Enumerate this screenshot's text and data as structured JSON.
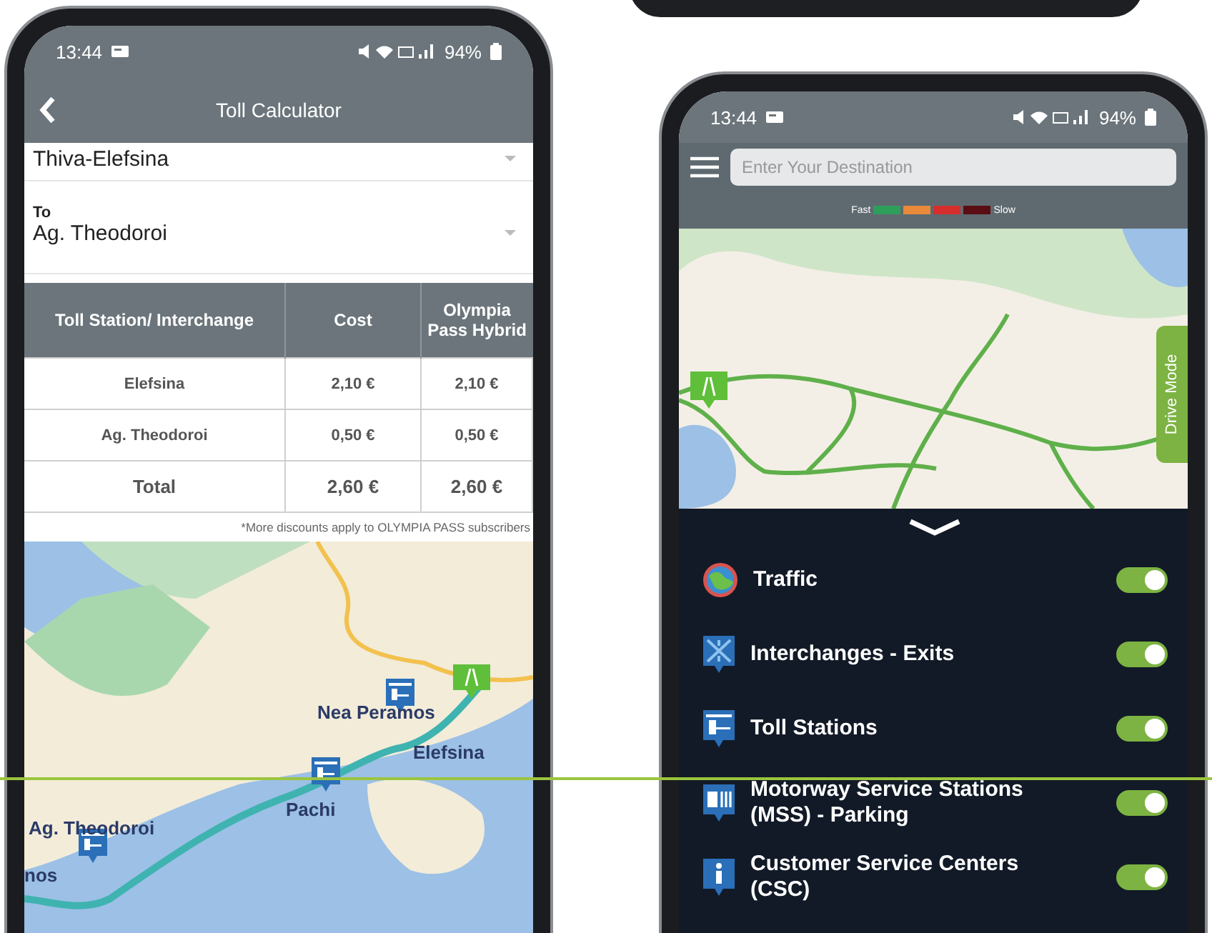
{
  "toll_calculator": {
    "status_bar": {
      "time": "13:44",
      "battery": "94%"
    },
    "title": "Toll Calculator",
    "from": {
      "value": "Thiva-Elefsina"
    },
    "to": {
      "label": "To",
      "value": "Ag. Theodoroi"
    },
    "table": {
      "columns": [
        "Toll Station/ Interchange",
        "Cost",
        "Olympia Pass Hybrid"
      ],
      "rows": [
        {
          "kind": "item",
          "cells": [
            "Elefsina",
            "2,10 €",
            "2,10 €"
          ]
        },
        {
          "kind": "item",
          "cells": [
            "Ag. Theodoroi",
            "0,50 €",
            "0,50 €"
          ]
        },
        {
          "kind": "total",
          "cells": [
            "Total",
            "2,60 €",
            "2,60 €"
          ]
        }
      ]
    },
    "note": "*More discounts apply to OLYMPIA PASS subscribers",
    "map": {
      "labels": [
        "Nea Peramos",
        "Elefsina",
        "Pachi",
        "Ag. Theodoroi",
        "nos"
      ]
    }
  },
  "map_screen": {
    "status_bar": {
      "time": "13:44",
      "battery": "94%"
    },
    "search": {
      "placeholder": "Enter Your Destination"
    },
    "legend": {
      "fast": "Fast",
      "slow": "Slow",
      "segments": [
        {
          "color": "#2e9e5b"
        },
        {
          "color": "#e88a3a"
        },
        {
          "color": "#d62d2d"
        },
        {
          "color": "#5a0d12"
        }
      ]
    },
    "drive_mode": "Drive Mode",
    "layers": [
      {
        "kind": "traffic",
        "label": "Traffic",
        "on": true
      },
      {
        "kind": "interchange",
        "label": "Interchanges - Exits",
        "on": true
      },
      {
        "kind": "toll",
        "label": "Toll Stations",
        "on": true
      },
      {
        "kind": "service",
        "label": "Motorway Service Stations (MSS) - Parking",
        "on": true
      },
      {
        "kind": "info",
        "label": "Customer Service Centers (CSC)",
        "on": true
      }
    ]
  }
}
